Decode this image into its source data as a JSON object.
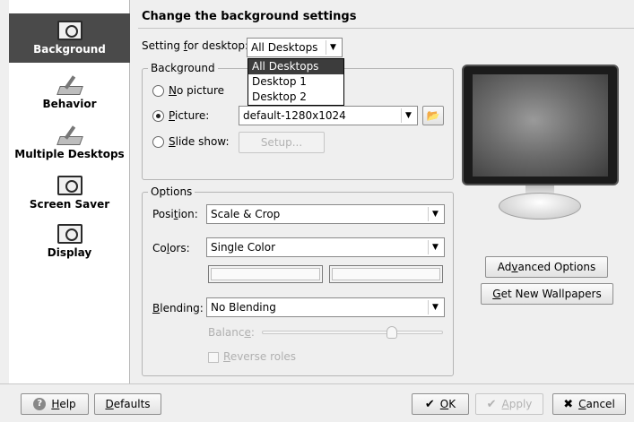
{
  "sidebar": {
    "items": [
      {
        "label": "Background",
        "icon": "monitor-icon",
        "selected": true
      },
      {
        "label": "Behavior",
        "icon": "tools-icon"
      },
      {
        "label": "Multiple Desktops",
        "icon": "tools-icon"
      },
      {
        "label": "Screen Saver",
        "icon": "monitor-icon"
      },
      {
        "label": "Display",
        "icon": "monitor-icon"
      }
    ]
  },
  "header": {
    "title": "Change the background settings"
  },
  "desktop_setting": {
    "label_pre": "Setting ",
    "label_u": "f",
    "label_post": "or desktop:",
    "selected": "All Desktops",
    "options": [
      "All Desktops",
      "Desktop 1",
      "Desktop 2"
    ]
  },
  "background_group": {
    "title": "Background",
    "no_picture_u": "N",
    "no_picture_rest": "o picture",
    "picture_u": "P",
    "picture_rest": "icture:",
    "picture_value": "default-1280x1024",
    "slideshow_u": "S",
    "slideshow_rest": "lide show:",
    "setup_label": "Setup..."
  },
  "options_group": {
    "title": "Options",
    "position_pre": "Posi",
    "position_u": "t",
    "position_post": "ion:",
    "position_value": "Scale & Crop",
    "colors_pre": "Co",
    "colors_u": "l",
    "colors_post": "ors:",
    "colors_value": "Single Color",
    "blending_u": "B",
    "blending_rest": "lending:",
    "blending_value": "No Blending",
    "balance_pre": "Balanc",
    "balance_u": "e",
    "balance_post": ":",
    "balance_level": 0.72,
    "reverse_u": "R",
    "reverse_rest": "everse roles"
  },
  "right_panel": {
    "advanced_pre": "Ad",
    "advanced_u": "v",
    "advanced_post": "anced Options",
    "wallpapers_u": "G",
    "wallpapers_rest": "et New Wallpapers"
  },
  "footer": {
    "help_u": "H",
    "help_rest": "elp",
    "defaults_u": "D",
    "defaults_rest": "efaults",
    "ok_u": "O",
    "ok_rest": "K",
    "apply_u": "A",
    "apply_rest": "pply",
    "cancel_u": "C",
    "cancel_rest": "ancel"
  },
  "colors": {
    "selection": "#3c3c3c",
    "sidebar_selected": "#4a4a4a",
    "window_bg": "#efefef"
  }
}
